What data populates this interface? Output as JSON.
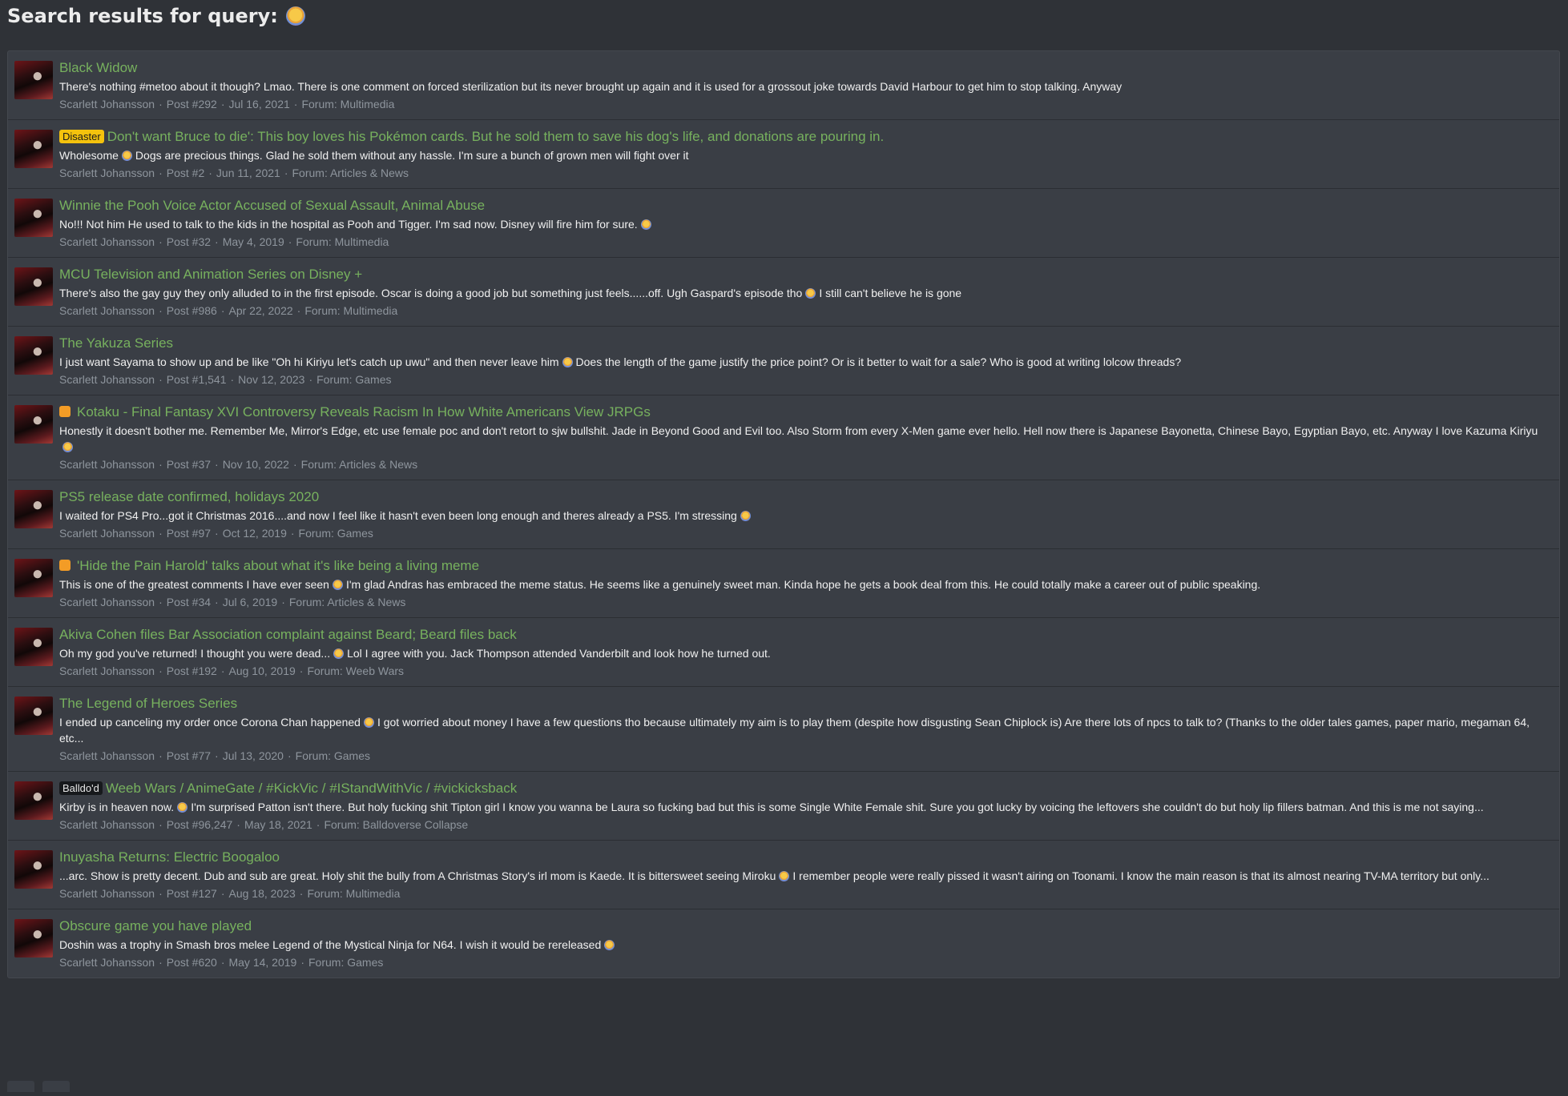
{
  "header": {
    "title": "Search results for query:"
  },
  "results": [
    {
      "label": "",
      "label_kind": "",
      "title": "Black Widow",
      "snippet_parts": [
        "There's nothing #metoo about it though? Lmao. There is one comment on forced sterilization but its never brought up again and it is used for a grossout joke towards David Harbour to get him to stop talking. Anyway"
      ],
      "author": "Scarlett Johansson",
      "post": "Post #292",
      "date": "Jul 16, 2021",
      "forum": "Forum: Multimedia"
    },
    {
      "label": "Disaster",
      "label_kind": "disaster",
      "title": "Don't want Bruce to die': This boy loves his Pokémon cards. But he sold them to save his dog's life, and donations are pouring in.",
      "snippet_parts": [
        "Wholesome",
        "Dogs are precious things. Glad he sold them without any hassle. I'm sure a bunch of grown men will fight over it"
      ],
      "author": "Scarlett Johansson",
      "post": "Post #2",
      "date": "Jun 11, 2021",
      "forum": "Forum: Articles & News"
    },
    {
      "label": "",
      "label_kind": "",
      "title": "Winnie the Pooh Voice Actor Accused of Sexual Assault, Animal Abuse",
      "snippet_parts": [
        "No!!! Not him He used to talk to the kids in the hospital as Pooh and Tigger. I'm sad now. Disney will fire him for sure.",
        ""
      ],
      "author": "Scarlett Johansson",
      "post": "Post #32",
      "date": "May 4, 2019",
      "forum": "Forum: Multimedia"
    },
    {
      "label": "",
      "label_kind": "",
      "title": "MCU Television and Animation Series on Disney +",
      "snippet_parts": [
        "There's also the gay guy they only alluded to in the first episode. Oscar is doing a good job but something just feels......off. Ugh Gaspard's episode tho",
        "I still can't believe he is gone"
      ],
      "author": "Scarlett Johansson",
      "post": "Post #986",
      "date": "Apr 22, 2022",
      "forum": "Forum: Multimedia"
    },
    {
      "label": "",
      "label_kind": "",
      "title": "The Yakuza Series",
      "snippet_parts": [
        "I just want Sayama to show up and be like \"Oh hi Kiriyu let's catch up uwu\" and then never leave him",
        "Does the length of the game justify the price point? Or is it better to wait for a sale? Who is good at writing lolcow threads?"
      ],
      "author": "Scarlett Johansson",
      "post": "Post #1,541",
      "date": "Nov 12, 2023",
      "forum": "Forum: Games"
    },
    {
      "label": "",
      "label_kind": "cat",
      "title": "Kotaku - Final Fantasy XVI Controversy Reveals Racism In How White Americans View JRPGs",
      "snippet_parts": [
        "Honestly it doesn't bother me. Remember Me, Mirror's Edge, etc use female poc and don't retort to sjw bullshit. Jade in Beyond Good and Evil too. Also Storm from every X-Men game ever hello. Hell now there is Japanese Bayonetta, Chinese Bayo, Egyptian Bayo, etc. Anyway I love Kazuma Kiriyu",
        ""
      ],
      "author": "Scarlett Johansson",
      "post": "Post #37",
      "date": "Nov 10, 2022",
      "forum": "Forum: Articles & News"
    },
    {
      "label": "",
      "label_kind": "",
      "title": "PS5 release date confirmed, holidays 2020",
      "snippet_parts": [
        "I waited for PS4 Pro...got it Christmas 2016....and now I feel like it hasn't even been long enough and theres already a PS5. I'm stressing",
        ""
      ],
      "author": "Scarlett Johansson",
      "post": "Post #97",
      "date": "Oct 12, 2019",
      "forum": "Forum: Games"
    },
    {
      "label": "",
      "label_kind": "cat",
      "title": "'Hide the Pain Harold' talks about what it's like being a living meme",
      "snippet_parts": [
        "This is one of the greatest comments I have ever seen",
        "I'm glad Andras has embraced the meme status. He seems like a genuinely sweet man. Kinda hope he gets a book deal from this. He could totally make a career out of public speaking."
      ],
      "author": "Scarlett Johansson",
      "post": "Post #34",
      "date": "Jul 6, 2019",
      "forum": "Forum: Articles & News"
    },
    {
      "label": "",
      "label_kind": "",
      "title": "Akiva Cohen files Bar Association complaint against Beard; Beard files back",
      "snippet_parts": [
        "Oh my god you've returned! I thought you were dead...",
        "Lol I agree with you. Jack Thompson attended Vanderbilt and look how he turned out."
      ],
      "author": "Scarlett Johansson",
      "post": "Post #192",
      "date": "Aug 10, 2019",
      "forum": "Forum: Weeb Wars"
    },
    {
      "label": "",
      "label_kind": "",
      "title": "The Legend of Heroes Series",
      "snippet_parts": [
        "I ended up canceling my order once Corona Chan happened",
        "I got worried about money I have a few questions tho because ultimately my aim is to play them (despite how disgusting Sean Chiplock is) Are there lots of npcs to talk to? (Thanks to the older tales games, paper mario, megaman 64, etc..."
      ],
      "author": "Scarlett Johansson",
      "post": "Post #77",
      "date": "Jul 13, 2020",
      "forum": "Forum: Games"
    },
    {
      "label": "Balldo'd",
      "label_kind": "dark",
      "title": "Weeb Wars / AnimeGate / #KickVic / #IStandWithVic / #vickicksback",
      "snippet_parts": [
        "Kirby is in heaven now.",
        "I'm surprised Patton isn't there. But holy fucking shit Tipton girl I know you wanna be Laura so fucking bad but this is some Single White Female shit. Sure you got lucky by voicing the leftovers she couldn't do but holy lip fillers batman. And this is me not saying..."
      ],
      "author": "Scarlett Johansson",
      "post": "Post #96,247",
      "date": "May 18, 2021",
      "forum": "Forum: Balldoverse Collapse"
    },
    {
      "label": "",
      "label_kind": "",
      "title": "Inuyasha Returns: Electric Boogaloo",
      "snippet_parts": [
        "...arc. Show is pretty decent. Dub and sub are great. Holy shit the bully from A Christmas Story's irl mom is Kaede. It is bittersweet seeing Miroku",
        "I remember people were really pissed it wasn't airing on Toonami. I know the main reason is that its almost nearing TV-MA territory but only..."
      ],
      "author": "Scarlett Johansson",
      "post": "Post #127",
      "date": "Aug 18, 2023",
      "forum": "Forum: Multimedia"
    },
    {
      "label": "",
      "label_kind": "",
      "title": "Obscure game you have played",
      "snippet_parts": [
        "Doshin was a trophy in Smash bros melee Legend of the Mystical Ninja for N64. I wish it would be rereleased",
        ""
      ],
      "author": "Scarlett Johansson",
      "post": "Post #620",
      "date": "May 14, 2019",
      "forum": "Forum: Games"
    }
  ]
}
